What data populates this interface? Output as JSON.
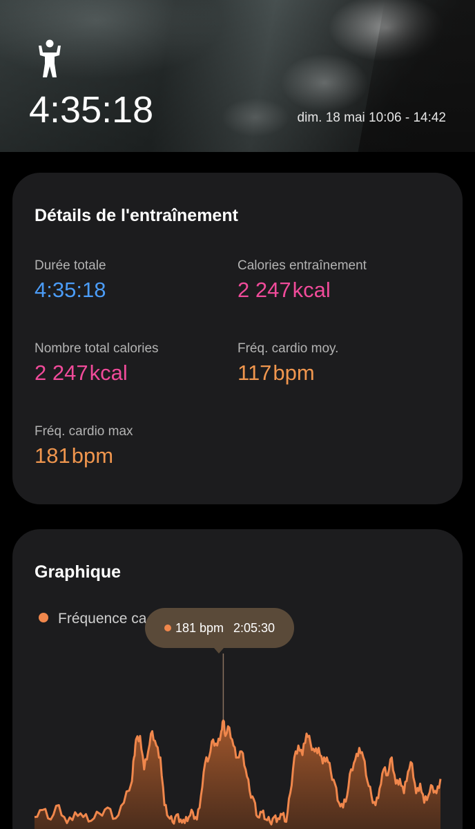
{
  "header": {
    "icon": "person-exercise-icon",
    "duration": "4:35:18",
    "date_range": "dim. 18 mai 10:06 - 14:42"
  },
  "details": {
    "title": "Détails de l'entraînement",
    "stats": [
      {
        "label": "Durée totale",
        "value": "4:35:18",
        "unit": "",
        "color": "#4b9cf7"
      },
      {
        "label": "Calories entraînement",
        "value": "2 247",
        "unit": "kcal",
        "color": "#f04b9a"
      },
      {
        "label": "Nombre total calories",
        "value": "2 247",
        "unit": "kcal",
        "color": "#f04b9a"
      },
      {
        "label": "Fréq. cardio moy.",
        "value": "117",
        "unit": "bpm",
        "color": "#f0964e"
      },
      {
        "label": "Fréq. cardio max",
        "value": "181",
        "unit": "bpm",
        "color": "#f0964e"
      }
    ]
  },
  "graph": {
    "title": "Graphique",
    "legend": "Fréquence ca",
    "tooltip": {
      "value": "181 bpm",
      "time": "2:05:30"
    },
    "chart_data": {
      "type": "area",
      "series": [
        {
          "color": "#f0874c",
          "x_fraction": [
            0.0,
            0.02,
            0.04,
            0.06,
            0.08,
            0.1,
            0.12,
            0.14,
            0.16,
            0.18,
            0.2,
            0.22,
            0.24,
            0.245,
            0.25,
            0.26,
            0.27,
            0.28,
            0.29,
            0.3,
            0.31,
            0.32,
            0.33,
            0.34,
            0.35,
            0.36,
            0.37,
            0.38,
            0.39,
            0.4,
            0.41,
            0.42,
            0.43,
            0.44,
            0.45,
            0.46,
            0.465,
            0.47,
            0.48,
            0.49,
            0.5,
            0.51,
            0.52,
            0.53,
            0.54,
            0.55,
            0.56,
            0.57,
            0.58,
            0.59,
            0.6,
            0.61,
            0.62,
            0.63,
            0.64,
            0.65,
            0.66,
            0.67,
            0.68,
            0.69,
            0.7,
            0.71,
            0.72,
            0.73,
            0.74,
            0.75,
            0.76,
            0.77,
            0.78,
            0.79,
            0.8,
            0.81,
            0.82,
            0.83,
            0.84,
            0.85,
            0.86,
            0.87,
            0.88,
            0.89,
            0.9,
            0.91,
            0.92,
            0.93,
            0.94,
            0.95,
            0.96,
            0.97,
            0.98,
            0.99,
            1.0
          ],
          "bpm": [
            100,
            106,
            98,
            110,
            95,
            104,
            100,
            97,
            103,
            108,
            99,
            112,
            130,
            150,
            165,
            168,
            140,
            155,
            172,
            160,
            150,
            110,
            100,
            96,
            102,
            98,
            95,
            100,
            104,
            98,
            118,
            145,
            150,
            165,
            160,
            172,
            181,
            168,
            175,
            160,
            150,
            155,
            140,
            122,
            115,
            100,
            104,
            98,
            96,
            100,
            99,
            102,
            96,
            120,
            150,
            160,
            152,
            170,
            162,
            155,
            158,
            145,
            150,
            138,
            128,
            112,
            108,
            118,
            140,
            148,
            158,
            150,
            130,
            118,
            110,
            124,
            140,
            135,
            150,
            128,
            132,
            120,
            138,
            145,
            120,
            128,
            112,
            118,
            126,
            120,
            132
          ]
        }
      ],
      "y_min_bpm": 90,
      "y_max_bpm": 185
    }
  }
}
